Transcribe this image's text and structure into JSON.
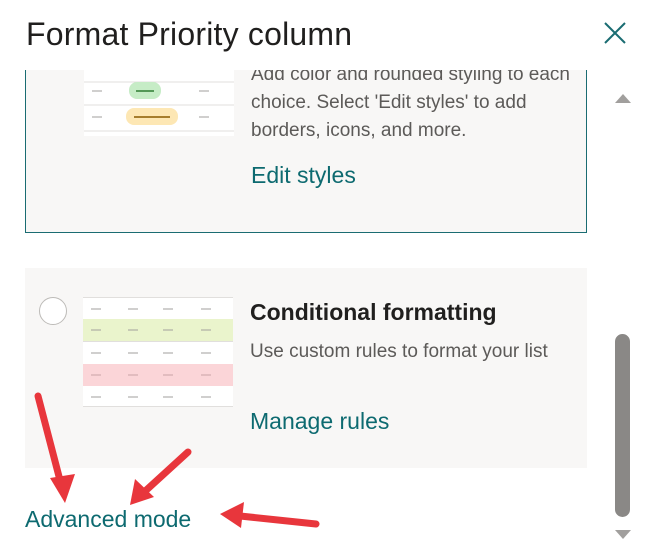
{
  "panel": {
    "title": "Format Priority column",
    "close_icon": "close-icon"
  },
  "options": [
    {
      "description": "Add color and rounded styling to each choice. Select 'Edit styles' to add borders, icons, and more.",
      "link": "Edit styles",
      "selected": true,
      "preview_icon": "choice-pills-preview-icon"
    },
    {
      "title": "Conditional formatting",
      "description": "Use custom rules to format your list",
      "link": "Manage rules",
      "selected": false,
      "preview_icon": "conditional-rows-preview-icon"
    }
  ],
  "footer": {
    "advanced_link": "Advanced mode"
  },
  "colors": {
    "accent": "#0d6a70",
    "annotation_arrow": "#e8363c",
    "pill_yellow": "#fde7b4",
    "pill_green": "#c6ecc6",
    "row_green": "#eaf4cc",
    "row_pink": "#fbd5d8"
  }
}
